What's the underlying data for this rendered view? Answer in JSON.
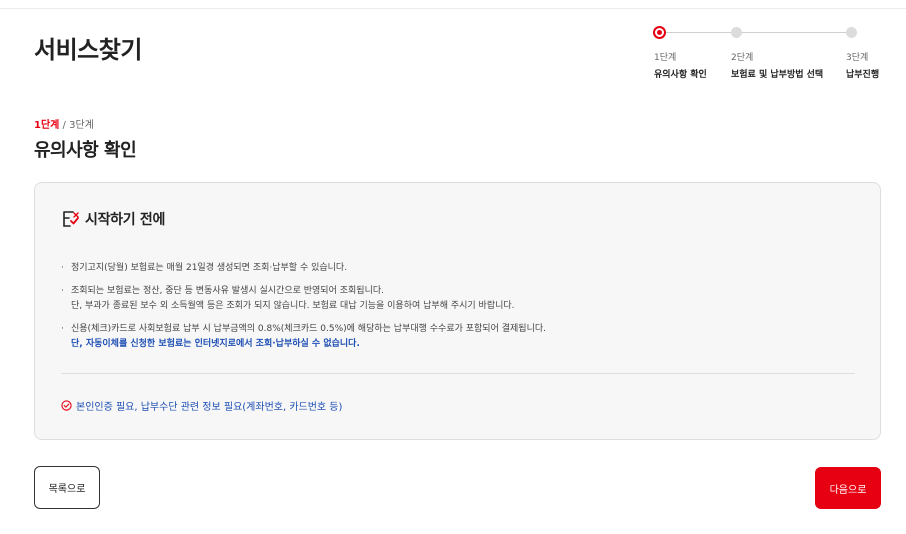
{
  "page": {
    "title": "서비스찾기"
  },
  "stepper": {
    "steps": [
      {
        "num": "1단계",
        "label": "유의사항 확인",
        "active": true
      },
      {
        "num": "2단계",
        "label": "보험료 및 납부방법 선택",
        "active": false
      },
      {
        "num": "3단계",
        "label": "납부진행",
        "active": false
      }
    ]
  },
  "section": {
    "current_step": "1단계",
    "total_steps": " / 3단계",
    "title": "유의사항 확인"
  },
  "notice": {
    "title": "시작하기 전에",
    "items": [
      {
        "lines": [
          "정기고지(당월) 보험료는 매월 21일경 생성되면 조회·납부할 수 있습니다."
        ]
      },
      {
        "lines": [
          "조회되는 보험료는 정산, 중단 등 변동사유 발생시 실시간으로 반영되어 조회됩니다.",
          "단, 부과가 종료된 보수 외 소득월액 등은 조회가 되지 않습니다. 보험료 대납 기능을 이용하여 납부해 주시기 바랍니다."
        ]
      },
      {
        "lines": [
          "신용(체크)카드로 사회보험료 납부 시 납부금액의 0.8%(체크카드 0.5%)에 해당하는 납부대행 수수료가 포함되어 결제됩니다.",
          "단, 자동이체를 신청한 보험료는 인터넷지로에서 조회·납부하실 수 없습니다."
        ]
      }
    ],
    "requirement": "본인인증 필요, 납부수단 관련 정보 필요(계좌번호, 카드번호 등)"
  },
  "buttons": {
    "list": "목록으로",
    "next": "다음으로"
  },
  "colors": {
    "accent": "#e60012",
    "link_blue": "#1e4fb4"
  }
}
